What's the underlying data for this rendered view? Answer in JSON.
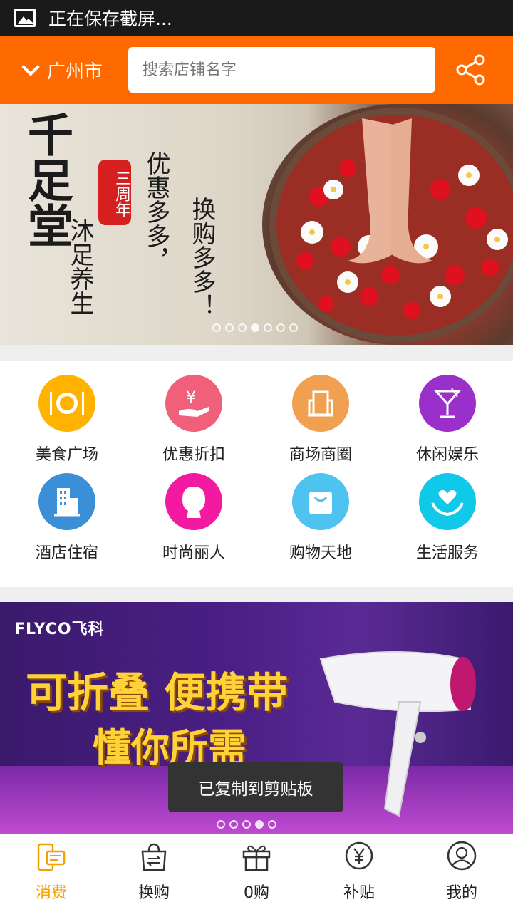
{
  "status_bar": {
    "text": "正在保存截屏..."
  },
  "header": {
    "city": "广州市",
    "search_placeholder": "搜索店铺名字"
  },
  "banner1": {
    "title": "千足堂",
    "subtitle": "沐足养生",
    "seal": "三周年",
    "slogan1": "优惠多多，",
    "slogan2": "换购多多！",
    "dots_total": 7,
    "dots_active": 4
  },
  "categories": [
    {
      "label": "美食广场",
      "icon": "dining-icon",
      "color": "#ffb300"
    },
    {
      "label": "优惠折扣",
      "icon": "discount-yen-icon",
      "color": "#f0607a"
    },
    {
      "label": "商场商圈",
      "icon": "mall-building-icon",
      "color": "#f0a050"
    },
    {
      "label": "休闲娱乐",
      "icon": "cocktail-icon",
      "color": "#9b2fc9"
    },
    {
      "label": "酒店住宿",
      "icon": "hotel-building-icon",
      "color": "#3a8fd6"
    },
    {
      "label": "时尚丽人",
      "icon": "woman-profile-icon",
      "color": "#f21aa0"
    },
    {
      "label": "购物天地",
      "icon": "shopping-bag-icon",
      "color": "#4fc3f0"
    },
    {
      "label": "生活服务",
      "icon": "heart-hands-icon",
      "color": "#10c9e8"
    }
  ],
  "banner2": {
    "brand": "FLYCO飞科",
    "line1": "可折叠 便携带",
    "line2": "懂你所需",
    "dots_total": 5,
    "dots_active": 4
  },
  "toast": {
    "text": "已复制到剪贴板"
  },
  "tabbar": [
    {
      "label": "消费",
      "icon": "phone-card-icon",
      "active": true
    },
    {
      "label": "换购",
      "icon": "exchange-bag-icon",
      "active": false
    },
    {
      "label": "0购",
      "icon": "gift-icon",
      "active": false
    },
    {
      "label": "补贴",
      "icon": "yen-circle-icon",
      "active": false
    },
    {
      "label": "我的",
      "icon": "user-icon",
      "active": false
    }
  ],
  "colors": {
    "brand": "#ff6a00",
    "active_tab": "#f5a000"
  }
}
